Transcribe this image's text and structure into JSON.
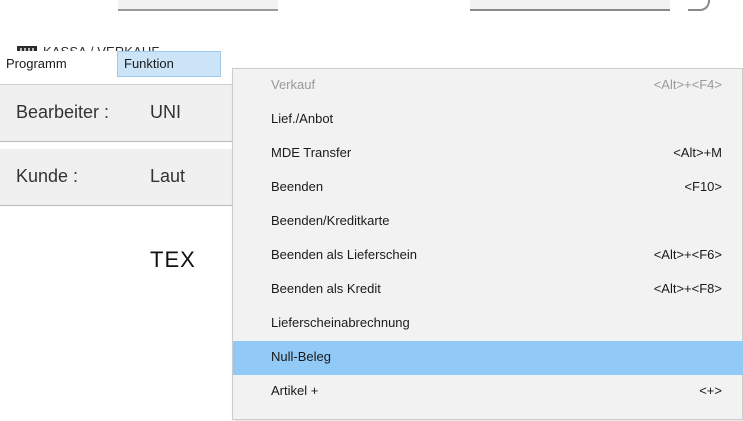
{
  "window": {
    "title": "KASSA / VERKAUF"
  },
  "menubar": {
    "items": [
      "Programm",
      "Funktion"
    ]
  },
  "panel": {
    "bearbeiter_label": "Bearbeiter :",
    "bearbeiter_value": "UNI",
    "kunde_label": "Kunde :",
    "kunde_value": "Laut",
    "big_text": "TEX"
  },
  "menu": {
    "items": [
      {
        "label": "Verkauf",
        "shortcut": "<Alt>+<F4>",
        "state": "disabled"
      },
      {
        "label": "Lief./Anbot",
        "shortcut": "",
        "state": "normal"
      },
      {
        "label": "MDE Transfer",
        "shortcut": "<Alt>+M",
        "state": "normal"
      },
      {
        "label": "Beenden",
        "shortcut": "<F10>",
        "state": "normal"
      },
      {
        "label": "Beenden/Kreditkarte",
        "shortcut": "",
        "state": "normal"
      },
      {
        "label": "Beenden als Lieferschein",
        "shortcut": "<Alt>+<F6>",
        "state": "normal"
      },
      {
        "label": "Beenden als Kredit",
        "shortcut": "<Alt>+<F8>",
        "state": "normal"
      },
      {
        "label": "Lieferscheinabrechnung",
        "shortcut": "",
        "state": "normal"
      },
      {
        "label": "Null-Beleg",
        "shortcut": "",
        "state": "highlighted"
      },
      {
        "label": "Artikel +",
        "shortcut": "<+>",
        "state": "normal"
      }
    ]
  }
}
